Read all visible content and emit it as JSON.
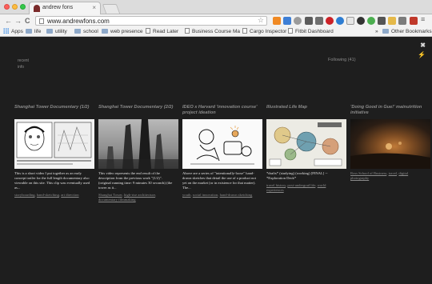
{
  "browser": {
    "tab_title": "andrew fons",
    "tab_close": "×",
    "url": "www.andrewfons.com",
    "back": "←",
    "forward": "→",
    "reload": "C",
    "star": "☆"
  },
  "bookmarks": [
    {
      "label": "Apps",
      "kind": "apps"
    },
    {
      "label": "life",
      "kind": "folder"
    },
    {
      "label": "utility",
      "kind": "folder"
    },
    {
      "label": "school",
      "kind": "folder"
    },
    {
      "label": "web presence",
      "kind": "folder"
    },
    {
      "label": "Read Later",
      "kind": "page"
    },
    {
      "label": "Business Course Ma",
      "kind": "page"
    },
    {
      "label": "Cargo Inspector",
      "kind": "page"
    },
    {
      "label": "Fitbit Dashboard",
      "kind": "page"
    },
    {
      "label": "»",
      "kind": "more"
    },
    {
      "label": "Other Bookmarks",
      "kind": "folder"
    }
  ],
  "page": {
    "nav": [
      "recent",
      "info"
    ],
    "following": "Following (41)",
    "icons": [
      "✖",
      "⚡"
    ]
  },
  "cards": [
    {
      "title": "Shanghai Tower Documentary (1/2)",
      "desc": "This is a short video I put together as an early concept trailer for the full length documentary also viewable on this site. This clip was eventually used as...",
      "tags": [
        "storyboarding",
        "hand-sketching",
        "art direction"
      ]
    },
    {
      "title": "Shanghai Tower Documentary (2/2)",
      "desc": "This video represents the end result of the description from the previous work \"(1/2)\". (original running time: 9 minutes 30 seconds) (the tower as it...",
      "tags": [
        "Shanghai Tower",
        "high-rise architecture",
        "documentary filmmaking"
      ]
    },
    {
      "title": "IDEO x Harvard 'innovation course' project ideation",
      "desc": "Above are a series of \"intentionally-loose\" hand-drawn sketches that detail the use of a product not yet on the market (or in existence for that matter). The...",
      "tags": [
        "youth",
        "social innovation",
        "hand-drawn sketching"
      ]
    },
    {
      "title": "Illustrated Life Map",
      "desc": "*drafts* (studying) (working) [FINAL] -- *Exploration Deck*",
      "tags": [
        "travel history",
        "post-undergrad life",
        "world experiences"
      ]
    },
    {
      "title": "'Doing Good in Gue!' mainutrition initiative",
      "desc": "",
      "tags": [
        "Ross School of Business",
        "travel",
        "digital photography"
      ]
    }
  ],
  "colors": {
    "page_bg": "#1e1e1e",
    "muted_text": "#8a8a8a",
    "body_text": "#e0e0e0"
  }
}
